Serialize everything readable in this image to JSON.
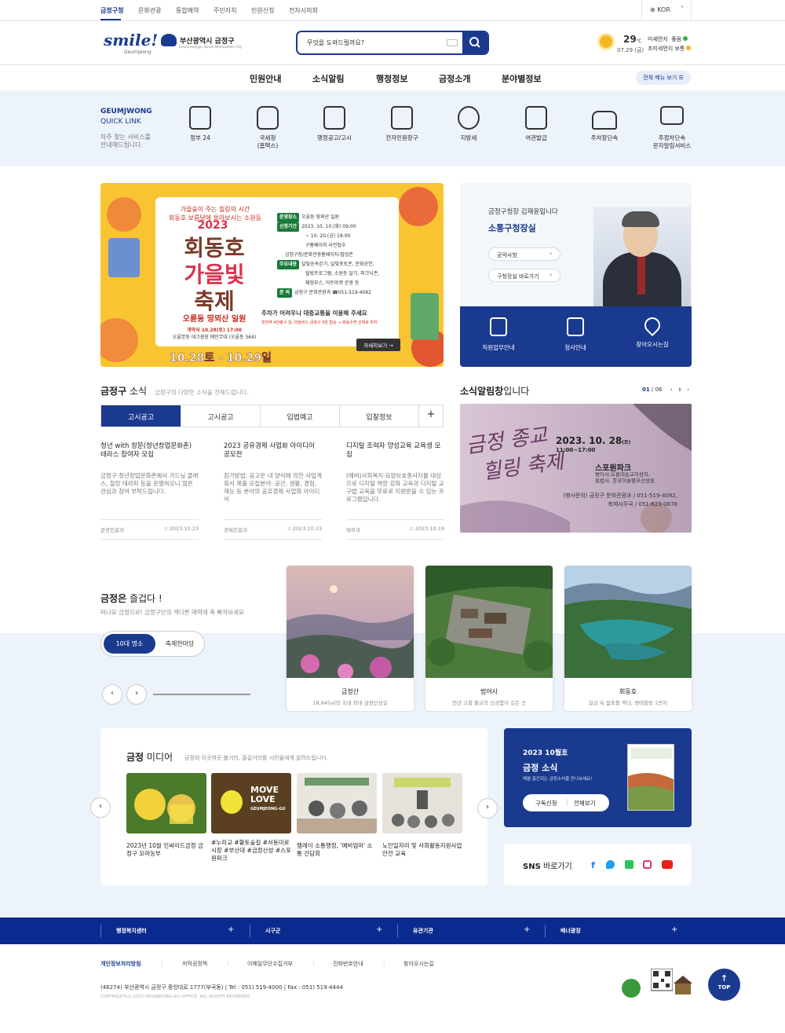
{
  "topbar": {
    "items": [
      "금정구청",
      "문화관광",
      "통합예약",
      "주민자치",
      "민원신청",
      "전자시의회"
    ],
    "language": "KOR"
  },
  "header": {
    "logo_text": "smile!",
    "logo_sub": "Geumjeong",
    "gu_name": "부산광역시 금정구",
    "gu_sub": "Geumjeong-gu, Busan Metropolitan City",
    "search_placeholder": "무엇을 도와드릴까요?",
    "weather": {
      "temp": "29",
      "unit": "℃",
      "date": "07.29 (금)",
      "pm10_label": "미세먼지",
      "pm10_value": "좋음",
      "pm25_label": "초미세먼지",
      "pm25_value": "보통",
      "good_color": "#36b24a",
      "normal_color": "#f3b61f"
    }
  },
  "gnb": {
    "items": [
      "민원안내",
      "소식알림",
      "행정정보",
      "금정소개",
      "분야별정보"
    ],
    "all_menu": "전체 메뉴 보기"
  },
  "quick": {
    "title_line1": "GEUMJWONG",
    "title_line2": "QUICK LINK",
    "desc_line1": "자주 찾는 서비스를",
    "desc_line2": "안내해드립니다.",
    "items": [
      {
        "label": "정부 24",
        "label2": "",
        "icon": "monitor-icon"
      },
      {
        "label": "국세청",
        "label2": "(홈택스)",
        "icon": "money-bag-icon"
      },
      {
        "label": "행정공고/고시",
        "label2": "",
        "icon": "clipboard-icon"
      },
      {
        "label": "전자민원창구",
        "label2": "",
        "icon": "person-monitor-icon"
      },
      {
        "label": "지방세",
        "label2": "",
        "icon": "won-icon"
      },
      {
        "label": "여권발급",
        "label2": "",
        "icon": "passport-icon"
      },
      {
        "label": "주차장단속",
        "label2": "",
        "icon": "car-icon"
      },
      {
        "label": "주정차단속",
        "label2": "문자알림서비스",
        "icon": "mail-icon"
      }
    ]
  },
  "banner": {
    "line1": "가을숲이 주는 힐링의 시간",
    "line1b": "회동호 보름달에 올라보시는 소원등",
    "year": "2023",
    "title1": "회동호",
    "title2": "가을빛",
    "title3": "축제",
    "place": "오륜동 땅뫼산 일원",
    "opening": "개막식 10.28(토) 17:00",
    "opening_place": "오륜본동 데크광장 메인무대 (오륜동 564)",
    "dates": "10.28토 - 10.29일",
    "info_place_tag": "운영장소",
    "info_place": "오륜동 땅뫼산 일원",
    "info_apply_tag": "신청기간",
    "info_apply": "2023. 10. 10.(화) 09:00",
    "info_apply2": "~ 10. 20.(금) 18:00",
    "info_apply3": "구홈페이지 사전접수",
    "info_apply4": "금정구청/문화관광홈페이지-팝업존",
    "info_main_tag": "주요내용",
    "info_main": "달빛송속걷기, 달빛포토존, 문화공연,",
    "info_main2": "힐링프로그램, 소원등 달기, 피크닉존,",
    "info_main3": "체험부스, 아트마켓 운영 등",
    "info_contact_tag": "문 의",
    "info_contact": "금정구 문화관광과 ☎051-519-4062",
    "parking": "주차가 어려우니 대중교통을 이용해 주세요",
    "parking2": "장전역 4번출구 앞, 마을버스 금정구 5번 탑승 → 회동수변 산책로 하차",
    "more": "자세히보기 →"
  },
  "mayor": {
    "greeting": "금정구청장 김재윤입니다",
    "title": "소통구청장실",
    "btn1": "공약사항",
    "btn2": "구청장실 바로가기",
    "bottom": [
      {
        "label": "직원업무안내",
        "icon": "staff-icon"
      },
      {
        "label": "청사안내",
        "icon": "building-icon"
      },
      {
        "label": "찾아오시는길",
        "icon": "map-pin-icon"
      }
    ]
  },
  "news": {
    "title_bold": "금정구",
    "title_light": " 소식",
    "subtitle": "금정구의 다양한 소식을 전해드립니다.",
    "tabs": [
      "고시공고",
      "고시공고",
      "입법예고",
      "입찰정보"
    ],
    "plus": "+",
    "items": [
      {
        "title": "청년 with 창문(청년창업문화촌) 테라스 참여자 모집",
        "desc": "금정구 청년창업문화촌에서 가드닝 클래스, 칠링 테라피 등을 운영하오니 많은 관심과 참여 부탁드립니다.",
        "dept": "관광진흥과",
        "date": "2023.10.23"
      },
      {
        "title": "2023 공유경제 사업화 아이디어 공모전",
        "desc": "참가방법: 공고문 내 양식에 의한 사업계획서 제출 모집분야: 공간, 생활, 경험, 재능 등 분야의 공유경제 사업화 아이디어",
        "dept": "경제진흥과",
        "date": "2023.10.23"
      },
      {
        "title": "디지털 조력자 양성교육 교육생 모집",
        "desc": "(예비)사회복지·요양보호종사자를 대상으로 디지털 역량 강화 교육과 디지털 교구법 교육을 무료로 지원받을 수 있는 프로그램입니다.",
        "dept": "재무과",
        "date": "2023.10.19"
      }
    ]
  },
  "popup": {
    "title_bold": "소식알림창",
    "title_light": "입니다",
    "page_current": "01",
    "page_total": "06",
    "calligraphy_line1": "금정 종교",
    "calligraphy_line2": "힐링 축제",
    "date": "2023. 10. 28",
    "date_day": "(토)",
    "time": "11:00~17:00",
    "place": "스포원파크",
    "place_sub1": "범어사,오륜대순교자성지,",
    "place_sub2": "홍법사, 한국이슬람부산성원",
    "contact1": "(행사문의) 금정구 문화관광과 / 051-519-4082,",
    "contact2": "축제사무국 / 051-623-0678"
  },
  "enjoy": {
    "title_bold": "금정은",
    "title_light": " 즐겁다 !",
    "subtitle": "떠나요 금정으로! 금정구만의 색다른 매력에 푹 빠져보세요",
    "toggle_on": "10대 명소",
    "toggle_off": "축제한마당",
    "prev": "‹",
    "next": "›",
    "cards": [
      {
        "name": "금정산",
        "desc": "18,845㎥의 국내 최대 금정산성길"
      },
      {
        "name": "범어사",
        "desc": "천년 고찰 불교의 신성함이 깃든 곳"
      },
      {
        "name": "회동호",
        "desc": "일상 속 쉼표를 찍다, 생태힐링 1번지"
      }
    ]
  },
  "media": {
    "title_bold": "금정",
    "title_light": " 미디어",
    "subtitle": "금정의 이곳저곳 볼거리, 즐길거리를 시민들에게 알려드립니다.",
    "videos": [
      {
        "title": "2023년 10월 인싸이드금정 금정구 꼬마농부"
      },
      {
        "title": "#누리교 #황토숲길 #서동미로시장 #부산대 #금정산성 #스포원파크",
        "thumb_text1": "MOVE",
        "thumb_text2": "LOVE",
        "thumb_text3": "GEUMJEONG-GU"
      },
      {
        "title": "렘레이 소통행정, '예비엄마' 소통 간담회"
      },
      {
        "title": "노인일자리 및 사회활동지원사업 안전 교육"
      }
    ],
    "prev": "‹",
    "next": "›"
  },
  "magazine": {
    "issue": "2023 10월호",
    "title": "금정 소식",
    "desc": "매월 출간되는 금정소식을 만나보세요!",
    "subscribe": "구독신청",
    "view_all": "전체보기"
  },
  "sns": {
    "label_bold": "SNS",
    "label_light": " 바로가기",
    "icons": [
      {
        "name": "facebook-icon",
        "color": "#1877f2",
        "glyph": "f"
      },
      {
        "name": "twitter-icon",
        "color": "#1da1f2",
        "glyph": "t"
      },
      {
        "name": "band-icon",
        "color": "#2bc45a",
        "glyph": "b"
      },
      {
        "name": "instagram-icon",
        "color": "#e1306c",
        "glyph": "◎"
      },
      {
        "name": "youtube-icon",
        "color": "#e62117",
        "glyph": "▶"
      }
    ]
  },
  "footer": {
    "bar_items": [
      "행정복지센터",
      "시구군",
      "유관기관",
      "배너광장"
    ],
    "links": [
      "개인정보처리방침",
      "저작권정책",
      "이메일무단수집거부",
      "전화번호안내",
      "찾아오시는길"
    ],
    "address": "(46274) 부산광역시 금정구 중앙대로 1777(부곡동) | Tel : 051) 519-4000 | Fax : 051) 519-4444",
    "copyright": "COPYRIGHT(c) 2023 GEUMJEONG-GU OFFICE. ALL RIGHTS RESERVED.",
    "top": "TOP",
    "top_arrow": "↑"
  }
}
